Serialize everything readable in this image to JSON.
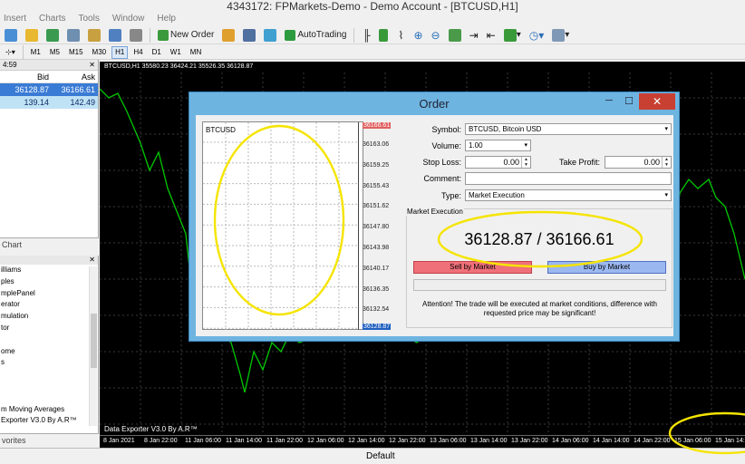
{
  "window": {
    "title": "4343172: FPMarkets-Demo - Demo Account - [BTCUSD,H1]"
  },
  "menu": [
    "Insert",
    "Charts",
    "Tools",
    "Window",
    "Help"
  ],
  "toolbar": {
    "new_order": "New Order",
    "autotrading": "AutoTrading"
  },
  "timeframes": [
    "M1",
    "M5",
    "M15",
    "M30",
    "H1",
    "H4",
    "D1",
    "W1",
    "MN"
  ],
  "active_timeframe": "H1",
  "market_watch": {
    "time": "4:59",
    "columns": {
      "bid": "Bid",
      "ask": "Ask"
    },
    "rows": [
      {
        "bid": "36128.87",
        "ask": "36166.61"
      },
      {
        "bid": "139.14",
        "ask": "142.49"
      }
    ],
    "tab": "Chart"
  },
  "navigator": {
    "items": [
      "illiams",
      "ples",
      "mplePanel",
      "erator",
      "mulation",
      "tor",
      "",
      "ome",
      "s",
      "",
      "",
      "",
      "m Moving Averages",
      "Exporter V3.0 By A.R™"
    ],
    "tab": "vorites"
  },
  "chart": {
    "header": "BTCUSD,H1  35580.23 36424.21 35526.35 36128.87",
    "footer": "Data Exporter V3.0 By A.R™",
    "x_ticks": [
      "8 Jan 2021",
      "8 Jan 22:00",
      "11 Jan 06:00",
      "11 Jan 14:00",
      "11 Jan 22:00",
      "12 Jan 06:00",
      "12 Jan 14:00",
      "12 Jan 22:00",
      "13 Jan 06:00",
      "13 Jan 14:00",
      "13 Jan 22:00",
      "14 Jan 06:00",
      "14 Jan 14:00",
      "14 Jan 22:00",
      "15 Jan 06:00",
      "15 Jan 14:0"
    ],
    "line_color": "#00c800"
  },
  "status": {
    "profile": "Default"
  },
  "order": {
    "title": "Order",
    "mini_chart": {
      "symbol": "BTCUSD",
      "price_labels": [
        "36166.61",
        "36163.06",
        "36159.25",
        "36155.43",
        "36151.62",
        "36147.80",
        "36143.98",
        "36140.17",
        "36136.35",
        "36132.54",
        "36128.87"
      ]
    },
    "form": {
      "symbol_label": "Symbol:",
      "symbol_value": "BTCUSD, Bitcoin USD",
      "volume_label": "Volume:",
      "volume_value": "1.00",
      "stoploss_label": "Stop Loss:",
      "stoploss_value": "0.00",
      "takeprofit_label": "Take Profit:",
      "takeprofit_value": "0.00",
      "comment_label": "Comment:",
      "comment_value": "",
      "type_label": "Type:",
      "type_value": "Market Execution"
    },
    "market_execution": {
      "title": "Market Execution",
      "price": "36128.87 / 36166.61",
      "sell_label": "Sell by Market",
      "buy_label": "Buy by Market",
      "attention": "Attention! The trade will be executed at market conditions, difference with requested price may be significant!"
    }
  },
  "colors": {
    "annotation": "#f5e400",
    "sell": "#f0707a",
    "buy": "#9bb8f0"
  }
}
